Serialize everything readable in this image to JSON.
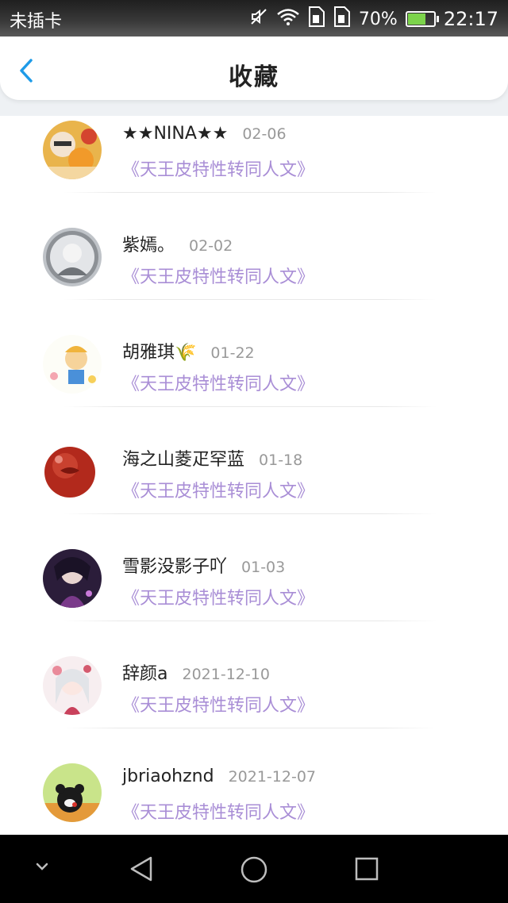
{
  "status_bar": {
    "carrier": "未插卡",
    "battery_percent": "70%",
    "time": "22:17"
  },
  "header": {
    "title": "收藏"
  },
  "favorites": [
    {
      "name": "★★NINA★★",
      "date": "02-06",
      "title": "《天王皮特性转同人文》"
    },
    {
      "name": "紫嫣。",
      "date": "02-02",
      "title": "《天王皮特性转同人文》"
    },
    {
      "name": "胡雅琪🌾",
      "date": "01-22",
      "title": "《天王皮特性转同人文》"
    },
    {
      "name": "海之山菱疋罕蓝",
      "date": "01-18",
      "title": "《天王皮特性转同人文》"
    },
    {
      "name": "雪影没影子吖",
      "date": "01-03",
      "title": "《天王皮特性转同人文》"
    },
    {
      "name": "辞颜a",
      "date": "2021-12-10",
      "title": "《天王皮特性转同人文》"
    },
    {
      "name": "jbriaohznd",
      "date": "2021-12-07",
      "title": "《天王皮特性转同人文》"
    }
  ],
  "colors": {
    "link": "#a98ed6",
    "accent": "#1e9be8"
  }
}
